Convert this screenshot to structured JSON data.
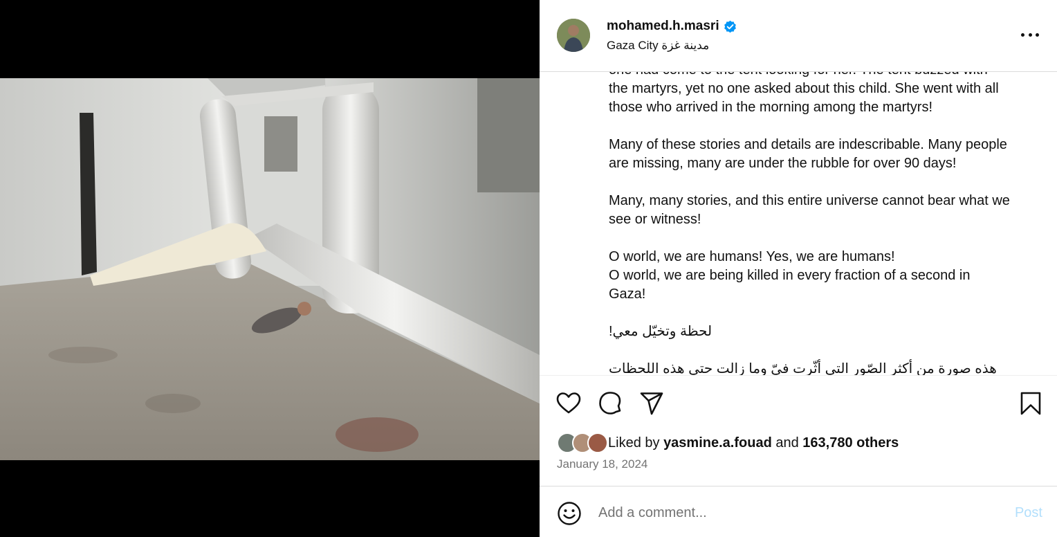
{
  "post": {
    "username": "mohamed.h.masri",
    "verified": true,
    "location": "Gaza City مدينة غزة",
    "more_icon": "more-horizontal-icon"
  },
  "caption": {
    "lines": [
      "one had come to the tent looking for her. The tent buzzed with",
      "the martyrs, yet no one asked about this child. She went with all",
      "those who arrived in the morning among the martyrs!",
      "",
      "Many of these stories and details are indescribable. Many people",
      "are missing, many are under the rubble for over 90 days!",
      "",
      "Many, many stories, and this entire universe cannot bear what we",
      "see or witness!",
      "",
      "O world, we are humans! Yes, we are humans!",
      "O world, we are being killed in every fraction of a second in",
      "Gaza!",
      "",
      "لحظة وتخيّل معي!",
      "",
      "هذه صورة من أكثر الصّور التي أثّرت فيّ وما زالت حتى هذه اللحظات"
    ]
  },
  "actions": {
    "icons": [
      "heart-icon",
      "comment-icon",
      "share-icon",
      "bookmark-icon"
    ]
  },
  "likes": {
    "prefix": "Liked by",
    "user": "yasmine.a.fouad",
    "joiner": "and",
    "count_text": "163,780 others"
  },
  "date": "January 18, 2024",
  "comment": {
    "placeholder": "Add a comment...",
    "post_label": "Post",
    "emoji_icon": "emoji-icon"
  },
  "colors": {
    "verified_blue": "#0095f6",
    "muted_text": "#737373",
    "post_disabled": "#b2dffc",
    "border": "#dbdbdb"
  }
}
